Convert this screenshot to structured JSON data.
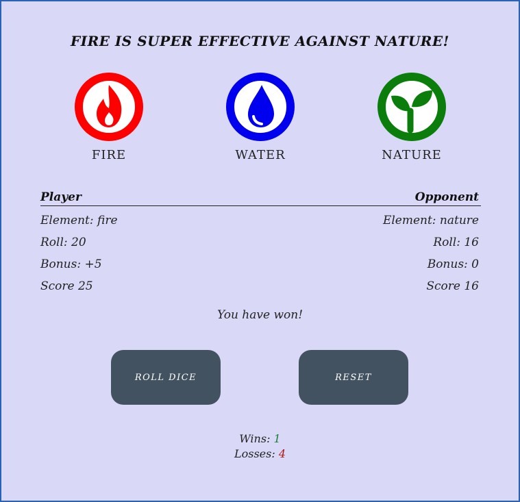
{
  "banner": "FIRE IS SUPER EFFECTIVE AGAINST NATURE!",
  "elements": [
    {
      "label": "FIRE",
      "icon": "flame-icon",
      "color": "#ff0000"
    },
    {
      "label": "WATER",
      "icon": "water-drop-icon",
      "color": "#0000ee"
    },
    {
      "label": "NATURE",
      "icon": "sprout-icon",
      "color": "#0a7d0a"
    }
  ],
  "player": {
    "heading": "Player",
    "element": "Element: fire",
    "roll": "Roll: 20",
    "bonus": "Bonus: +5",
    "score": "Score 25"
  },
  "opponent": {
    "heading": "Opponent",
    "element": "Element: nature",
    "roll": "Roll: 16",
    "bonus": "Bonus: 0",
    "score": "Score 16"
  },
  "result": "You have won!",
  "buttons": {
    "roll": "ROLL DICE",
    "reset": "RESET"
  },
  "tally": {
    "wins_label": "Wins: ",
    "wins": "1",
    "losses_label": "Losses: ",
    "losses": "4"
  },
  "colors": {
    "background": "#d9d9f7",
    "button": "#435261",
    "wins": "#1a7d3b",
    "losses": "#b01717"
  }
}
